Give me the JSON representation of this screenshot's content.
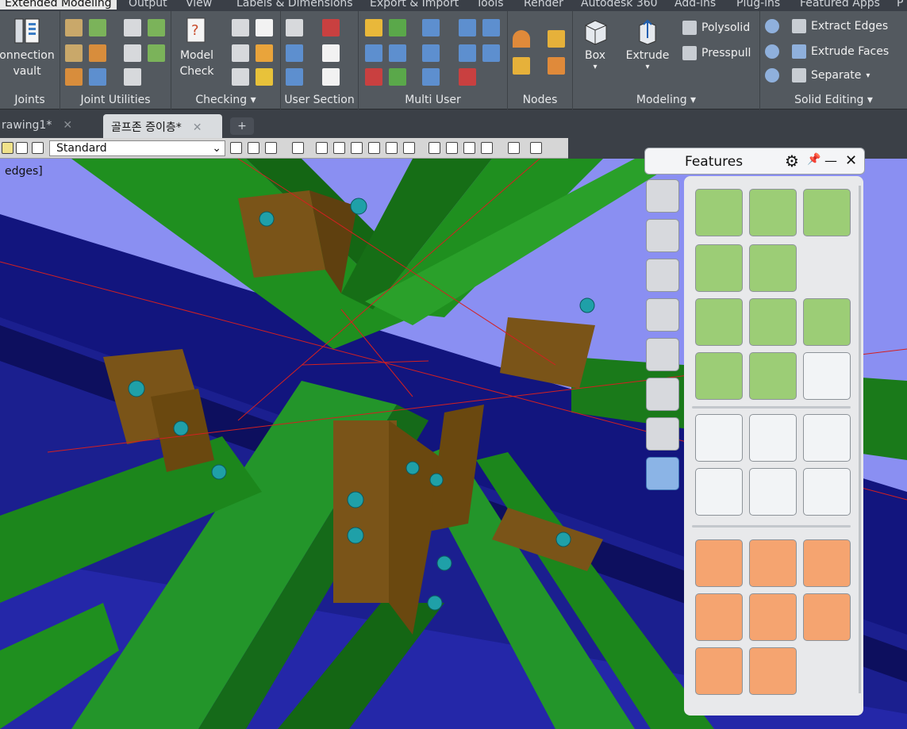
{
  "menubar": {
    "tabs": [
      "Extended Modeling",
      "Output",
      "View",
      "Labels & Dimensions",
      "Export & Import",
      "Tools",
      "Render",
      "Autodesk 360",
      "Add-ins",
      "Plug-ins",
      "Featured Apps",
      "P"
    ]
  },
  "ribbon": {
    "joints": {
      "label": "Joints",
      "button": {
        "line1": "onnection",
        "line2": "vault"
      }
    },
    "joint_utilities": {
      "label": "Joint Utilities"
    },
    "checking": {
      "label": "Checking",
      "button": {
        "line1": "Model",
        "line2": "Check"
      }
    },
    "user_section": {
      "label": "User Section"
    },
    "multi_user": {
      "label": "Multi User"
    },
    "nodes": {
      "label": "Nodes"
    },
    "modeling": {
      "label": "Modeling",
      "box": "Box",
      "extrude": "Extrude",
      "polysolid": "Polysolid",
      "presspull": "Presspull"
    },
    "solid_editing": {
      "label": "Solid Editing",
      "extract_edges": "Extract Edges",
      "extrude_faces": "Extrude Faces",
      "separate": "Separate"
    }
  },
  "tabs": {
    "doc1": "rawing1*",
    "doc2": "골프존 증이층*",
    "close": "✕",
    "add": "+"
  },
  "toolbar": {
    "style_value": "Standard"
  },
  "viewport": {
    "label": "edges]"
  },
  "features_panel": {
    "title": "Features",
    "gear": "⚙",
    "pin": "📌",
    "minimize": "—",
    "close": "✕"
  }
}
